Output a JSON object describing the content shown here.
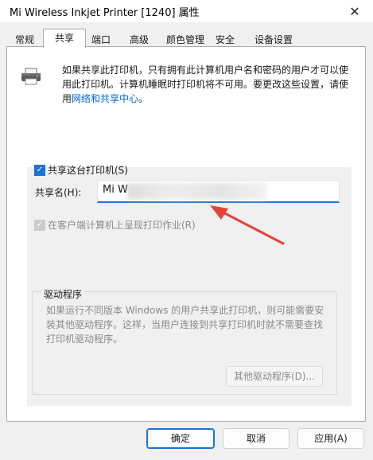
{
  "window": {
    "title": "Mi Wireless Inkjet Printer [1240] 属性",
    "close_glyph": "✕"
  },
  "tabs": [
    {
      "label": "常规"
    },
    {
      "label": "共享"
    },
    {
      "label": "端口"
    },
    {
      "label": "高级"
    },
    {
      "label": "颜色管理"
    },
    {
      "label": "安全"
    },
    {
      "label": "设备设置"
    }
  ],
  "info": {
    "text": "如果共享此打印机，只有拥有此计算机用户名和密码的用户才可以使用此打印机。计算机睡眠时打印机将不可用。要更改这些设置，请使用",
    "link": "网络和共享中心",
    "suffix": "。"
  },
  "share": {
    "checkbox_label": "共享这台打印机(S)",
    "checked": true,
    "name_label": "共享名(H):",
    "name_value": "Mi W",
    "render_label": "在客户端计算机上呈现打印作业(R)",
    "render_checked": true
  },
  "drivers": {
    "group_label": "驱动程序",
    "text": "如果运行不同版本 Windows 的用户共享此打印机，则可能需要安装其他驱动程序。这样，当用户连接到共享打印机时就不需要查找打印机驱动程序。",
    "button": "其他驱动程序(D)..."
  },
  "buttons": {
    "ok": "确定",
    "cancel": "取消",
    "apply": "应用(A)"
  },
  "colors": {
    "accent": "#1a73d9",
    "annotation_arrow": "#e8413c"
  }
}
